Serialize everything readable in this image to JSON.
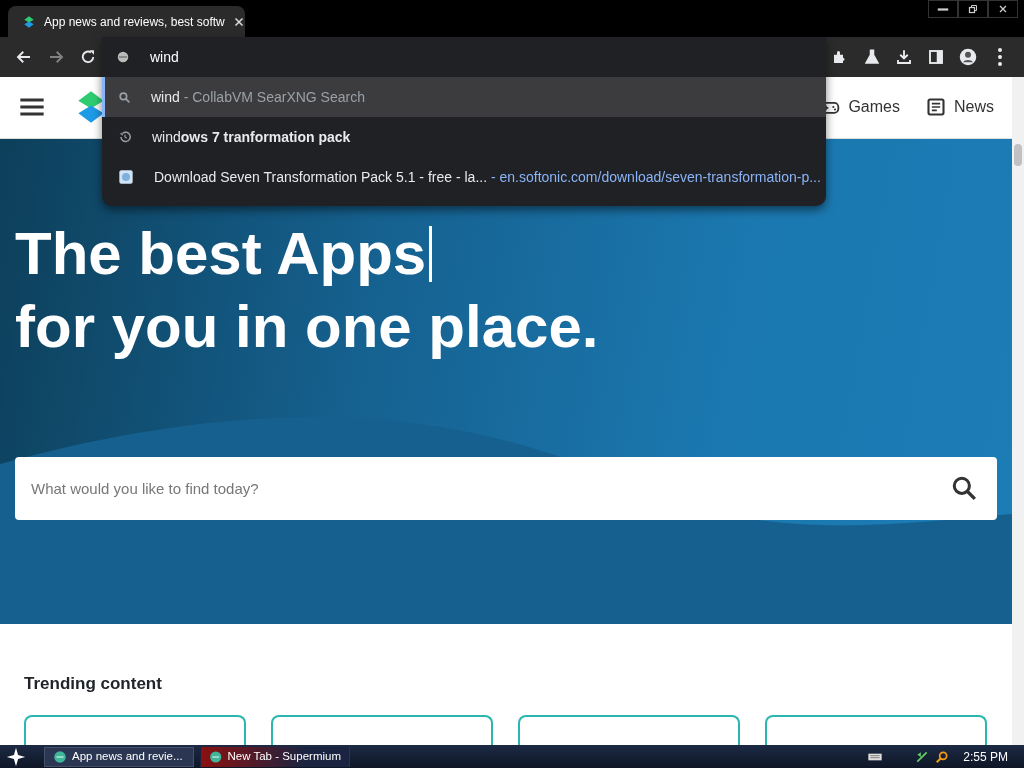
{
  "browser": {
    "tab": {
      "title": "App news and reviews, best softw",
      "selected": true
    },
    "back": {
      "disabled": false
    },
    "forward": {
      "disabled": true
    },
    "omnibox": {
      "value": "wind",
      "suggestions": [
        {
          "kind": "search",
          "selected": true,
          "text": "wind",
          "hint": " - CollabVM SearXNG Search"
        },
        {
          "kind": "history",
          "selected": false,
          "text": "wind**ows 7 tranformation pack**"
        },
        {
          "kind": "page",
          "selected": false,
          "text": "Download Seven Transformation Pack 5.1 - free - la...",
          "hint": " - en.softonic.com/download/seven-transformation-p..."
        }
      ]
    }
  },
  "site": {
    "nav": [
      "Games",
      "News"
    ],
    "headline": [
      "The best Apps",
      "for you in one place."
    ],
    "search": {
      "placeholder": "What would you like to find today?"
    },
    "trending_title": "Trending content"
  },
  "taskbar": {
    "tasks": [
      {
        "label": "App news and revie...",
        "selected": true
      },
      {
        "label": "New Tab - Supermium",
        "selected": false
      }
    ],
    "time": "2:55 PM"
  }
}
